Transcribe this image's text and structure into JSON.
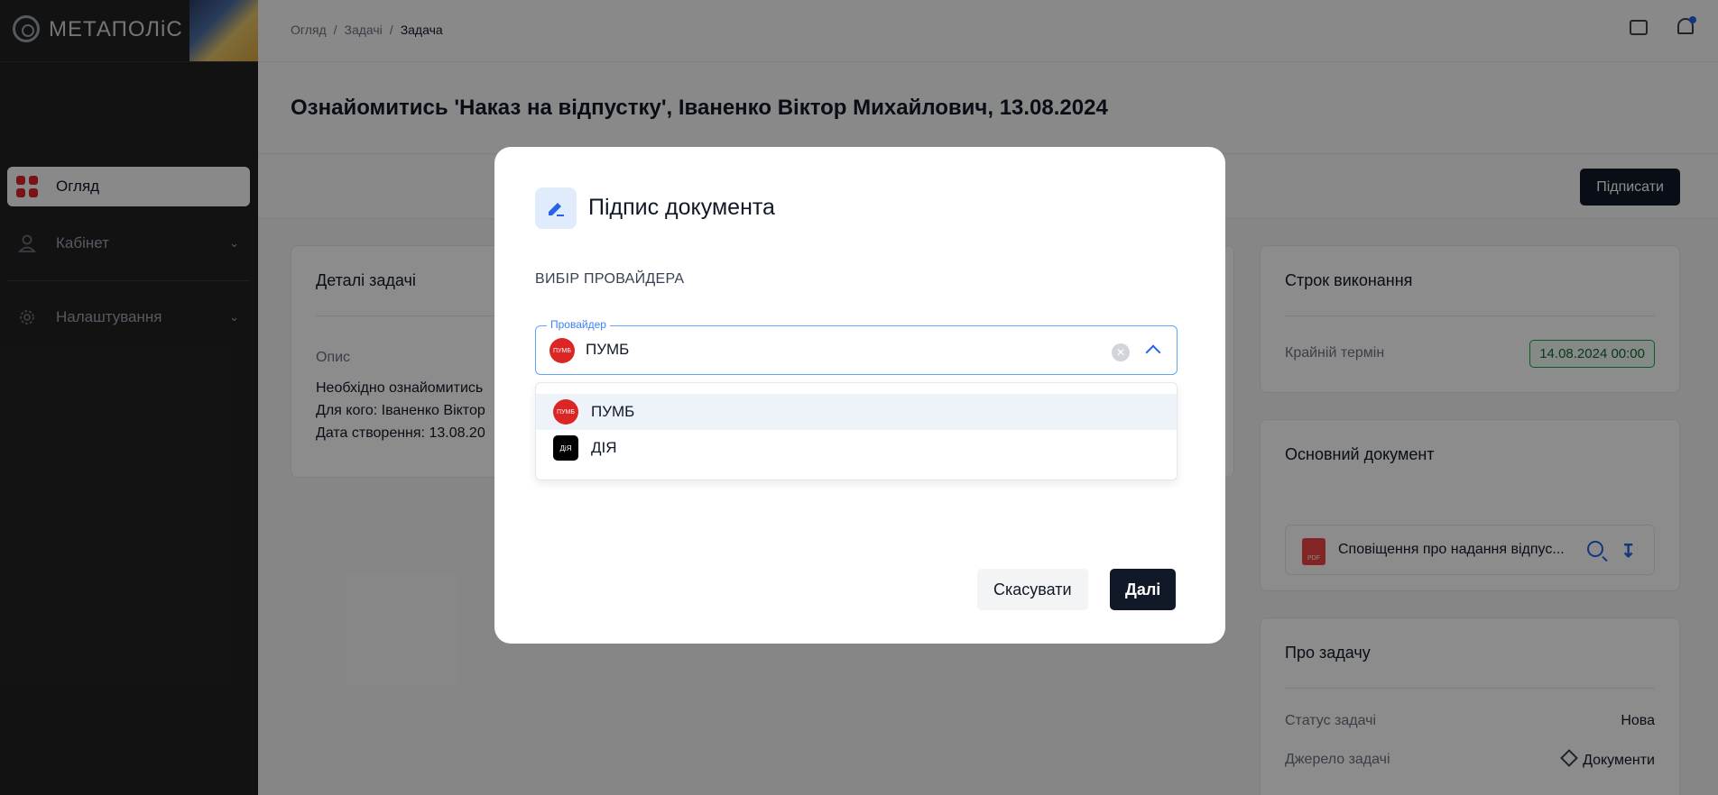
{
  "sidebar": {
    "logo_text": "МЕТАПОЛіС",
    "items": [
      {
        "label": "Огляд"
      },
      {
        "label": "Кабінет"
      },
      {
        "label": "Налаштування"
      }
    ]
  },
  "breadcrumb": {
    "items": [
      "Огляд",
      "Задачі",
      "Задача"
    ],
    "separator": "/"
  },
  "page": {
    "title": "Ознайомитись 'Наказ на відпустку', Іваненко Віктор Михайлович, 13.08.2024",
    "sign_label": "Підписати"
  },
  "details_card": {
    "title": "Деталі задачі",
    "desc_label": "Опис",
    "lines": [
      "Необхідно ознайомитись",
      "Для кого: Іваненко Віктор",
      "Дата створення: 13.08.20"
    ]
  },
  "deadline_card": {
    "title": "Строк виконання",
    "label": "Крайній термін",
    "value": "14.08.2024 00:00"
  },
  "document_card": {
    "title": "Основний документ",
    "file_name": "Сповіщення про надання відпус...",
    "file_type": "PDF"
  },
  "about_card": {
    "title": "Про задачу",
    "status_label": "Статус задачі",
    "status_value": "Нова",
    "source_label": "Джерело задачі",
    "source_value": "Документи"
  },
  "modal": {
    "title": "Підпис документа",
    "section_label": "ВИБІР ПРОВАЙДЕРА",
    "field_label": "Провайдер",
    "selected_value": "ПУМБ",
    "options": [
      {
        "label": "ПУМБ",
        "logo_text": "ПУМБ",
        "color": "#dc2626"
      },
      {
        "label": "ДІЯ",
        "logo_text": "ДіЯ",
        "color": "#000000"
      }
    ],
    "cancel_label": "Скасувати",
    "next_label": "Далі"
  }
}
